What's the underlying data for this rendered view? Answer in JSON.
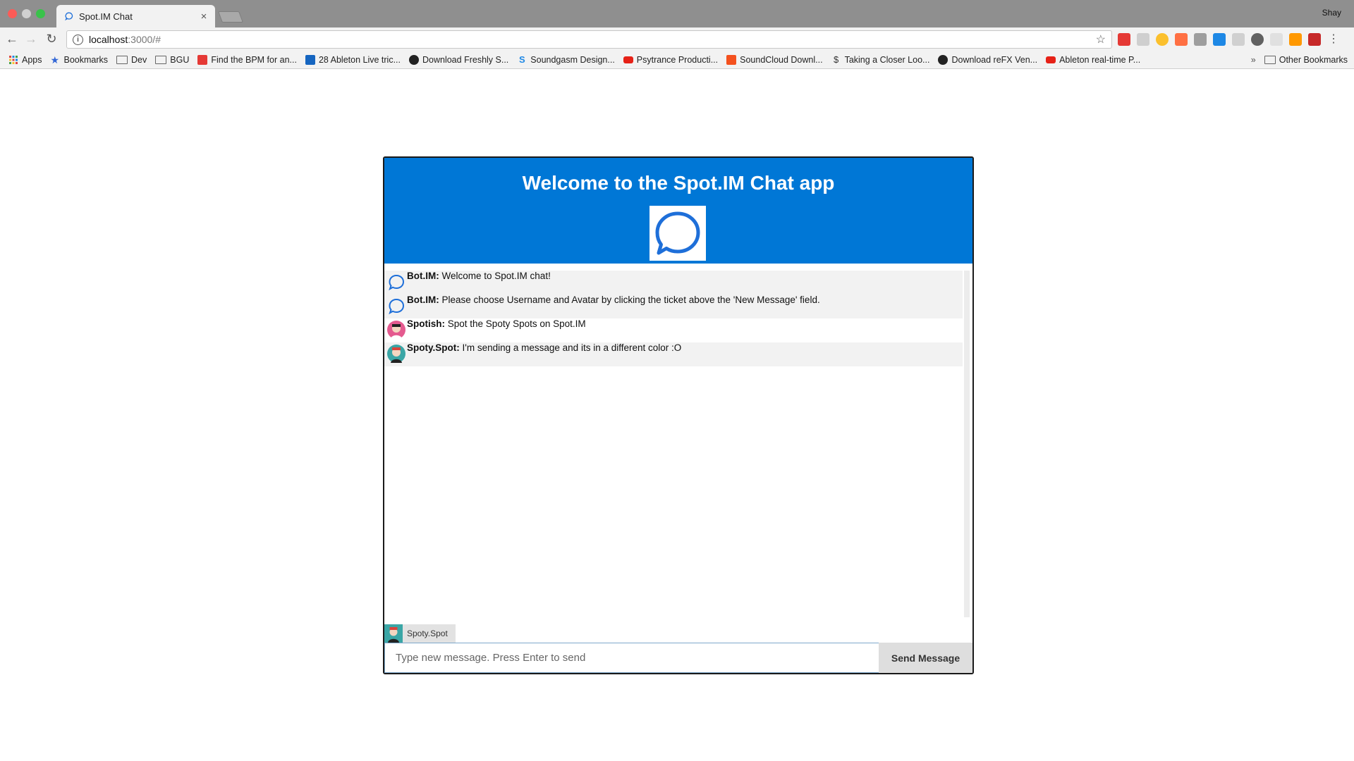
{
  "browser": {
    "tab_title": "Spot.IM Chat",
    "tab_close": "×",
    "profile_name": "Shay",
    "url_host": "localhost",
    "url_rest": ":3000/#",
    "nav": {
      "back": "←",
      "forward": "→",
      "reload": "↻"
    },
    "star": "☆",
    "info": "i",
    "bookmarks": [
      {
        "label": "Apps",
        "icon": "apps-grid-icon",
        "color": "#d44"
      },
      {
        "label": "Bookmarks",
        "icon": "star-icon",
        "color": "#3367d6"
      },
      {
        "label": "Dev",
        "icon": "folder-icon"
      },
      {
        "label": "BGU",
        "icon": "folder-icon"
      },
      {
        "label": "Find the BPM for an...",
        "icon": "bolt-icon",
        "color": "#e53935"
      },
      {
        "label": "28 Ableton Live tric...",
        "icon": "mr-icon",
        "color": "#1565c0"
      },
      {
        "label": "Download Freshly S...",
        "icon": "circle-r-icon",
        "color": "#222"
      },
      {
        "label": "Soundgasm Design...",
        "icon": "s-icon",
        "color": "#1e88e5"
      },
      {
        "label": "Psytrance Producti...",
        "icon": "youtube-icon",
        "color": "#e62117"
      },
      {
        "label": "SoundCloud Downl...",
        "icon": "s-square-icon",
        "color": "#f4511e"
      },
      {
        "label": "Taking a Closer Loo...",
        "icon": "dollar-s-icon",
        "color": "#333"
      },
      {
        "label": "Download reFX Ven...",
        "icon": "circle-r-icon",
        "color": "#222"
      },
      {
        "label": "Ableton real-time P...",
        "icon": "youtube-icon",
        "color": "#e62117"
      }
    ],
    "more_bookmarks": "»",
    "other_bookmarks": "Other Bookmarks"
  },
  "chat": {
    "title": "Welcome to the Spot.IM Chat app",
    "messages": [
      {
        "author": "Bot.IM:",
        "text": "Welcome to Spot.IM chat!",
        "avatar": "bot-bubble-icon"
      },
      {
        "author": "Bot.IM:",
        "text": "Please choose Username and Avatar by clicking the ticket above the 'New Message' field.",
        "avatar": "bot-bubble-icon"
      },
      {
        "author": "Spotish:",
        "text": "Spot the Spoty Spots on Spot.IM",
        "avatar": "pink-avatar"
      },
      {
        "author": "Spoty.Spot:",
        "text": "I'm sending a message and its in a different color :O",
        "avatar": "teal-avatar"
      }
    ],
    "current_user": "Spoty.Spot",
    "input_placeholder": "Type new message. Press Enter to send",
    "send_label": "Send Message",
    "colors": {
      "header": "#0077d6",
      "alt_row": "#f2f2f2"
    }
  }
}
